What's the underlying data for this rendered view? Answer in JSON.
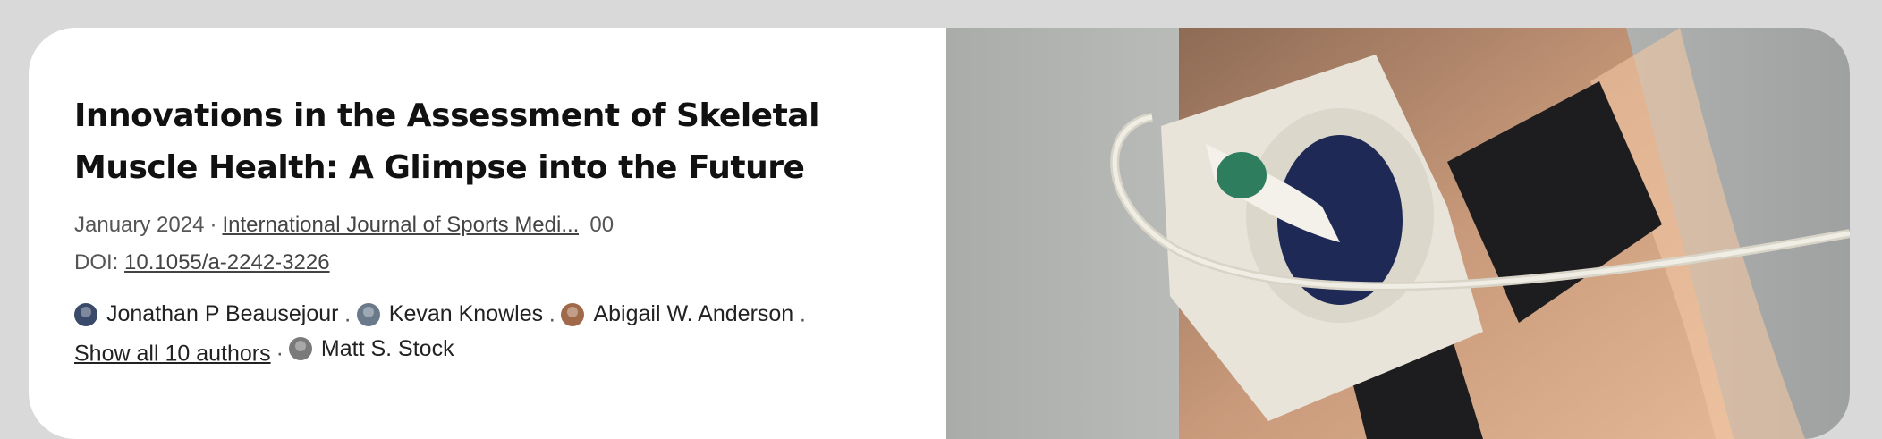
{
  "article": {
    "title": "Innovations in the Assessment of Skeletal Muscle Health: A Glimpse into the Future",
    "date": "January 2024",
    "separator": "·",
    "journal": "International Journal of Sports Medi...",
    "reads": "00",
    "doi_label": "DOI:",
    "doi": "10.1055/a-2242-3226"
  },
  "authors": {
    "list": [
      {
        "name": "Jonathan P Beausejour",
        "avatar_color": "#3a4a6b"
      },
      {
        "name": "Kevan Knowles",
        "avatar_color": "#6b7a8a"
      },
      {
        "name": "Abigail W. Anderson",
        "avatar_color": "#a06a4a"
      }
    ],
    "show_all": "Show all 10 authors",
    "last": {
      "name": "Matt S. Stock",
      "avatar_color": "#7a7a7a"
    }
  },
  "image": {
    "icon": "ultrasound-probe-on-arm-image",
    "background_color": "#bdbfbe"
  }
}
